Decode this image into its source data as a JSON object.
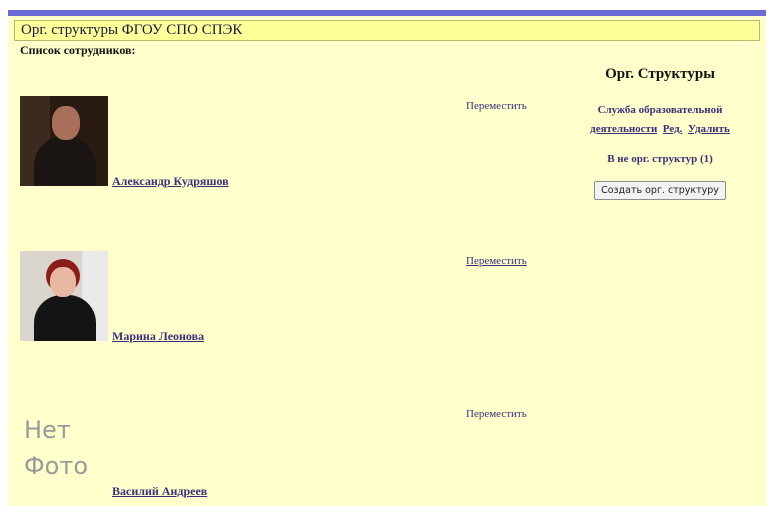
{
  "header": {
    "title": "Орг. структуры ФГОУ СПО СПЭК"
  },
  "list": {
    "title": "Список сотрудников:",
    "employees": [
      {
        "name": "Александр Кудряшов",
        "move_label": "Переместить",
        "photo": "photo"
      },
      {
        "name": "Марина Леонова",
        "move_label": "Переместить",
        "photo": "photo"
      },
      {
        "name": "Василий Андреев",
        "move_label": "Переместить",
        "photo_placeholder_line1": "Нет",
        "photo_placeholder_line2": "Фото"
      }
    ]
  },
  "sidebar": {
    "title": "Орг. Структуры",
    "structure_line1": "Служба образовательной",
    "structure_line2": "деятельности",
    "edit_label": "Ред.",
    "delete_label": "Удалить",
    "no_structure_label": "В не орг. структур (1)",
    "create_button": "Создать орг. структуру"
  },
  "colors": {
    "background": "#ffffcc",
    "title_bar": "#ffff99",
    "top_stripe": "#6b6bd6",
    "link": "#3a2f7a"
  }
}
